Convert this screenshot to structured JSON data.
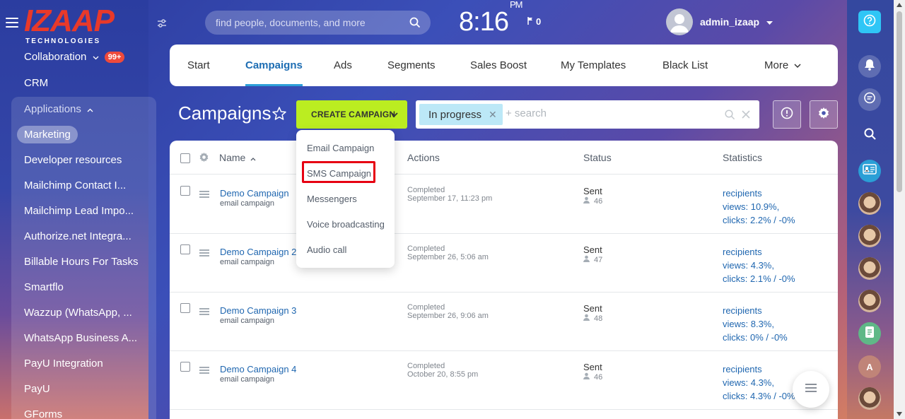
{
  "header": {
    "logo_main": "IZAAP",
    "logo_sub": "TECHNOLOGIES",
    "search_placeholder": "find people, documents, and more",
    "clock_time": "8:16",
    "clock_ampm": "PM",
    "flag_count": "0",
    "user_name": "admin_izaap"
  },
  "sidebar": {
    "collaboration": "Collaboration",
    "collaboration_badge": "99+",
    "crm": "CRM",
    "applications": "Applications",
    "marketing": "Marketing",
    "items": [
      "Developer resources",
      "Mailchimp Contact I...",
      "Mailchimp Lead Impo...",
      "Authorize.net Integra...",
      "Billable Hours For Tasks",
      "Smartflo",
      "Wazzup (WhatsApp, ...",
      "WhatsApp Business A...",
      "PayU Integration",
      "PayU",
      "GForms"
    ]
  },
  "tabs": [
    "Start",
    "Campaigns",
    "Ads",
    "Segments",
    "Sales Boost",
    "My Templates",
    "Black List",
    "More"
  ],
  "toolbar": {
    "page_title": "Campaigns",
    "create_label": "CREATE CAMPAIGN",
    "filter_chip": "In progress",
    "search_placeholder": "+ search"
  },
  "dropdown": [
    "Email Campaign",
    "SMS Campaign",
    "Messengers",
    "Voice broadcasting",
    "Audio call"
  ],
  "grid": {
    "headers": {
      "name": "Name",
      "actions": "Actions",
      "status": "Status",
      "statistics": "Statistics"
    },
    "rows": [
      {
        "name": "Demo Campaign",
        "type": "email campaign",
        "action": "Completed",
        "date": "September 17, 11:23 pm",
        "status": "Sent",
        "count": "46",
        "recipients": "recipients",
        "views": "views: 10.9%,",
        "clicks": "clicks: 2.2% / -0%"
      },
      {
        "name": "Demo Campaign 2",
        "type": "email campaign",
        "action": "Completed",
        "date": "September 26, 5:06 am",
        "status": "Sent",
        "count": "47",
        "recipients": "recipients",
        "views": "views: 4.3%,",
        "clicks": "clicks: 2.1% / -0%"
      },
      {
        "name": "Demo Campaign 3",
        "type": "email campaign",
        "action": "Completed",
        "date": "September 26, 9:06 am",
        "status": "Sent",
        "count": "48",
        "recipients": "recipients",
        "views": "views: 8.3%,",
        "clicks": "clicks: 0% / -0%"
      },
      {
        "name": "Demo Campaign 4",
        "type": "email campaign",
        "action": "Completed",
        "date": "October 20, 8:55 pm",
        "status": "Sent",
        "count": "46",
        "recipients": "recipients",
        "views": "views: 4.3%,",
        "clicks": "clicks: 4.3% / -0%"
      }
    ]
  },
  "rightbar": {
    "avatar_letter": "A"
  },
  "colors": {
    "accent_green": "#bbed21",
    "link_blue": "#2067b0",
    "help_cyan": "#2fc6f6",
    "highlight_red": "#e60012",
    "badge_red": "#ef4a3b"
  }
}
